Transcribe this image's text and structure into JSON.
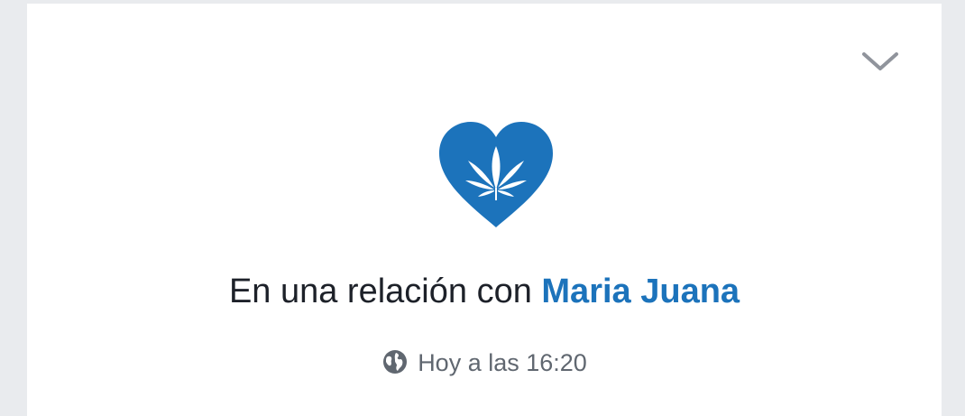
{
  "post": {
    "event_prefix": "En una relación con",
    "partner_name": "Maria Juana",
    "privacy_icon": "globe-icon",
    "timestamp": "Hoy a las 16:20"
  },
  "icons": {
    "heart": "heart-icon",
    "leaf": "cannabis-leaf-icon",
    "options": "chevron-down-icon"
  },
  "colors": {
    "accent": "#1c73bb",
    "text": "#1d2129",
    "meta_text": "#606770",
    "chevron": "#90949c",
    "background": "#e9ebee",
    "card": "#ffffff"
  }
}
